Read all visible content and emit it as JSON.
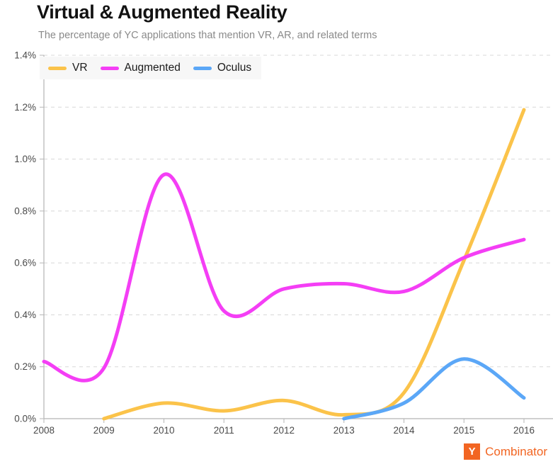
{
  "header": {
    "title": "Virtual & Augmented Reality",
    "subtitle": "The percentage of YC applications that mention VR, AR, and related terms"
  },
  "branding": {
    "mark_letter": "Y",
    "wordmark": "Combinator",
    "brand_color": "#F26522"
  },
  "legend": {
    "position": "top-left",
    "entries": [
      {
        "label": "VR",
        "color": "#FBC34A"
      },
      {
        "label": "Augmented",
        "color": "#F43EF5"
      },
      {
        "label": "Oculus",
        "color": "#5BA7F7"
      }
    ]
  },
  "chart_data": {
    "type": "line",
    "title": "Virtual & Augmented Reality",
    "subtitle": "The percentage of YC applications that mention VR, AR, and related terms",
    "xlabel": "",
    "ylabel": "",
    "x": [
      2008,
      2009,
      2010,
      2011,
      2012,
      2013,
      2014,
      2015,
      2016
    ],
    "xtick_labels": [
      "2008",
      "2009",
      "2010",
      "2011",
      "2012",
      "2013",
      "2014",
      "2015",
      "2016"
    ],
    "xlim": [
      2008,
      2016
    ],
    "ylim": [
      0.0,
      1.4
    ],
    "ytick_labels": [
      "0.0%",
      "0.2%",
      "0.4%",
      "0.6%",
      "0.8%",
      "1.0%",
      "1.2%",
      "1.4%"
    ],
    "ytick_values": [
      0.0,
      0.2,
      0.4,
      0.6,
      0.8,
      1.0,
      1.2,
      1.4
    ],
    "units": "percent",
    "grid": "horizontal-dashed",
    "legend_position": "top-left",
    "series": [
      {
        "name": "VR",
        "color": "#FBC34A",
        "x": [
          2009,
          2010,
          2011,
          2012,
          2013,
          2014,
          2015,
          2016
        ],
        "values": [
          0.0,
          0.06,
          0.03,
          0.07,
          0.015,
          0.1,
          0.61,
          1.19
        ]
      },
      {
        "name": "Augmented",
        "color": "#F43EF5",
        "x": [
          2008,
          2009,
          2010,
          2011,
          2012,
          2013,
          2014,
          2015,
          2016
        ],
        "values": [
          0.22,
          0.195,
          0.94,
          0.415,
          0.5,
          0.52,
          0.49,
          0.62,
          0.69
        ]
      },
      {
        "name": "Oculus",
        "color": "#5BA7F7",
        "x": [
          2013,
          2014,
          2015,
          2016
        ],
        "values": [
          0.0,
          0.06,
          0.23,
          0.08
        ]
      }
    ]
  }
}
